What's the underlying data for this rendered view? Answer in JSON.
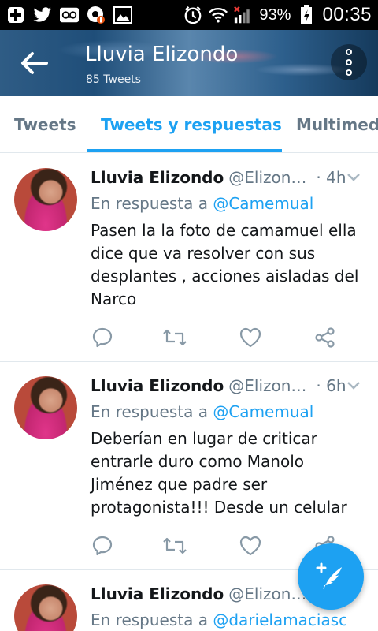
{
  "status_bar": {
    "icons": [
      "plus-icon",
      "twitter-icon",
      "voicemail-icon",
      "notification-icon",
      "image-icon",
      "alarm-icon",
      "wifi-icon",
      "signal-icon"
    ],
    "battery_percent": "93%",
    "time": "00:35"
  },
  "header": {
    "title": "Lluvia Elizondo",
    "subtitle": "85 Tweets"
  },
  "tabs": [
    {
      "label": "Tweets",
      "active": false
    },
    {
      "label": "Tweets y respuestas",
      "active": true
    },
    {
      "label": "Multimedia",
      "active": false
    }
  ],
  "tweets": [
    {
      "name": "Lluvia Elizondo",
      "handle": "@Elizon…",
      "time": "· 4h",
      "reply_prefix": "En respuesta a ",
      "reply_to": "@Camemual",
      "text": "Pasen la la foto de camamuel ella dice que va resolver con sus desplantes , acciones aisladas del Narco"
    },
    {
      "name": "Lluvia Elizondo",
      "handle": "@Elizon…",
      "time": "· 6h",
      "reply_prefix": "En respuesta a ",
      "reply_to": "@Camemual",
      "text": "Deberían en lugar de criticar entrarle duro como Manolo Jiménez que padre ser protagonista!!! Desde un celular"
    },
    {
      "name": "Lluvia Elizondo",
      "handle": "@Elizon…",
      "time": "",
      "reply_prefix": "En respuesta a ",
      "reply_to": "@darielamaciasc",
      "text": ""
    }
  ],
  "colors": {
    "accent": "#1da1f2",
    "text_secondary": "#657786",
    "divider": "#e1e8ed"
  }
}
